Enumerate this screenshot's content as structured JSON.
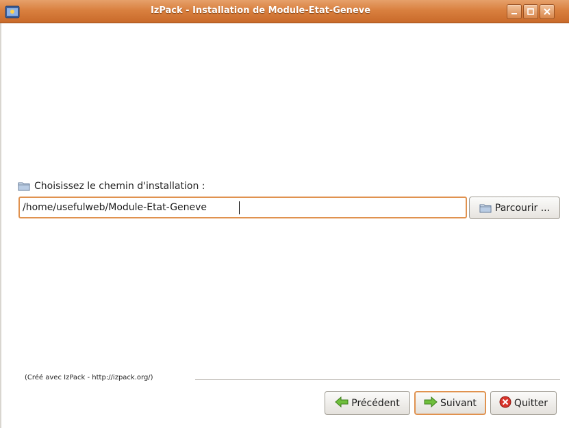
{
  "window": {
    "title": "IzPack - Installation de Module-Etat-Geneve"
  },
  "path": {
    "label": "Choisissez le chemin d'installation :",
    "value": "/home/usefulweb/Module-Etat-Geneve",
    "browse_label": "Parcourir ..."
  },
  "footer": {
    "credit": "(Créé avec IzPack - http://izpack.org/)"
  },
  "nav": {
    "previous_label": "Précédent",
    "next_label": "Suivant",
    "quit_label": "Quitter"
  },
  "icons": {
    "app": "installer-icon",
    "folder": "folder-icon",
    "previous": "arrow-left-icon",
    "next": "arrow-right-icon",
    "quit": "close-circle-icon"
  },
  "colors": {
    "titlebar": "#d9803f",
    "focus_border": "#e0924f"
  }
}
